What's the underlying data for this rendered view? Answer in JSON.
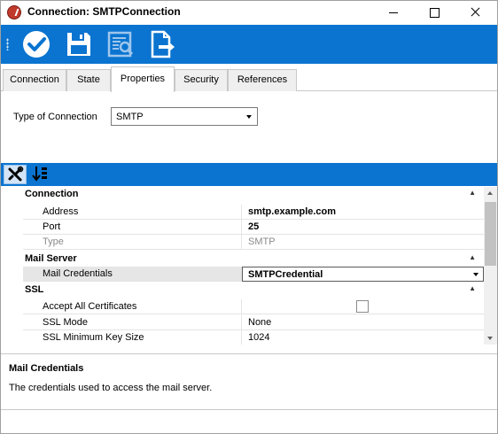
{
  "window": {
    "title": "Connection: SMTPConnection"
  },
  "toolbar": {
    "icons": [
      "checkmark-circle-icon",
      "save-disk-icon",
      "view-details-icon",
      "export-document-icon"
    ],
    "accent_color": "#0a74d0"
  },
  "tabs": [
    {
      "label": "Connection",
      "active": false
    },
    {
      "label": "State",
      "active": false
    },
    {
      "label": "Properties",
      "active": true
    },
    {
      "label": "Security",
      "active": false
    },
    {
      "label": "References",
      "active": false
    }
  ],
  "connection_type": {
    "label": "Type of Connection",
    "value": "SMTP"
  },
  "property_grid": {
    "view_mode": "categorized",
    "categories": [
      {
        "name": "Connection",
        "expanded": true,
        "properties": [
          {
            "name": "Address",
            "value": "smtp.example.com"
          },
          {
            "name": "Port",
            "value": "25"
          },
          {
            "name": "Type",
            "value": "SMTP"
          }
        ]
      },
      {
        "name": "Mail Server",
        "expanded": true,
        "properties": [
          {
            "name": "Mail Credentials",
            "value": "SMTPCredential"
          }
        ]
      },
      {
        "name": "SSL",
        "expanded": true,
        "properties": [
          {
            "name": "Accept All Certificates",
            "value": false
          },
          {
            "name": "SSL Mode",
            "value": "None"
          },
          {
            "name": "SSL Minimum Key Size",
            "value": "1024"
          }
        ]
      }
    ]
  },
  "help": {
    "title": "Mail Credentials",
    "description": "The credentials used to access the mail server."
  }
}
